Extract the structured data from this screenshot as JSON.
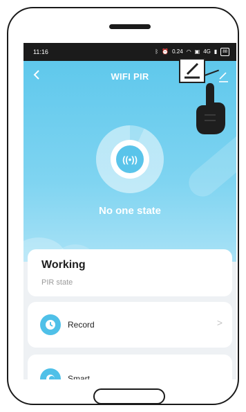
{
  "status_bar": {
    "time": "11:16",
    "icons": [
      "nfc-icon",
      "alarm-icon",
      "data-speed-icon",
      "wifi-icon",
      "hd-icon",
      "signal-icon",
      "battery-icon"
    ],
    "speed": "0.24",
    "network": "4G",
    "battery_level": "88"
  },
  "header": {
    "title": "WIFI PIR",
    "back_icon": "back-chevron-icon",
    "edit_icon": "pencil-icon"
  },
  "sensor": {
    "icon": "broadcast-icon",
    "symbol": "((•))",
    "state_text": "No one state"
  },
  "working_card": {
    "title": "Working",
    "subtitle": "PIR state"
  },
  "rows": [
    {
      "label": "Record",
      "icon": "clock-icon",
      "chevron": ">"
    },
    {
      "label": "Smart",
      "icon": "smart-icon"
    }
  ],
  "colors": {
    "accent": "#5fc8ec",
    "icon_blue": "#4fc0e8",
    "card_bg": "#ffffff",
    "screen_bg": "#eef1f4"
  }
}
